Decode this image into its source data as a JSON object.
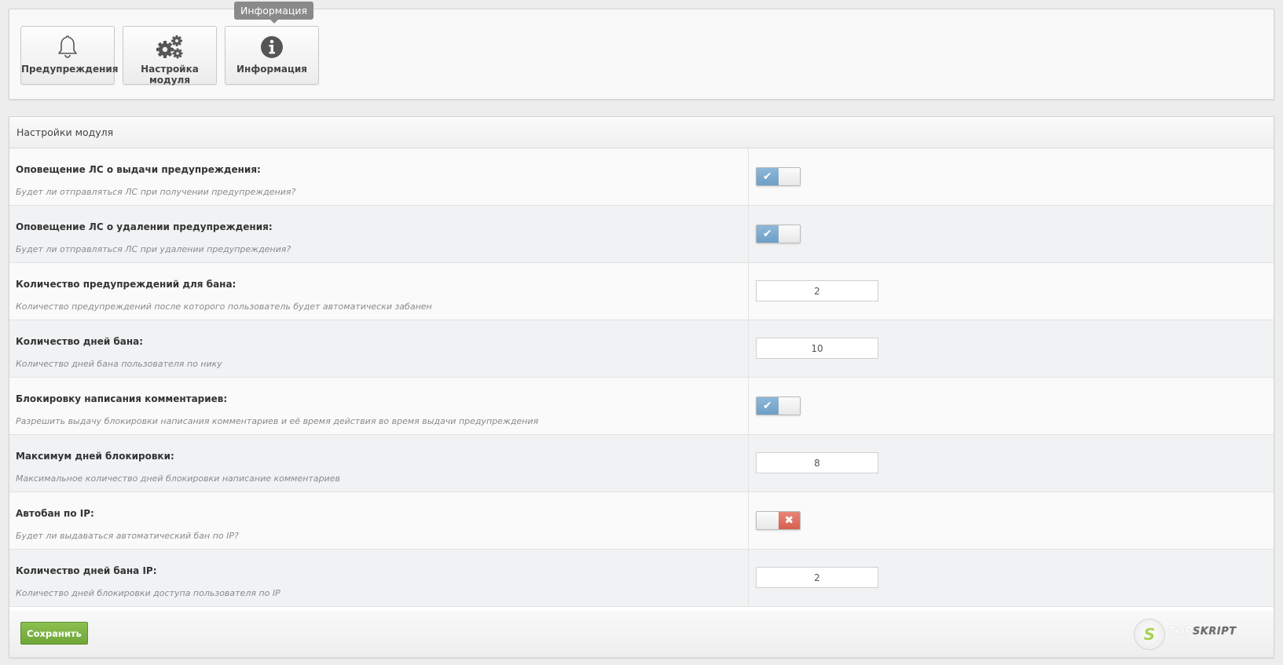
{
  "toolbar": {
    "buttons": [
      {
        "label": "Предупреждения",
        "icon": "bell-icon"
      },
      {
        "label": "Настройка модуля",
        "icon": "gears-icon"
      },
      {
        "label": "Информация",
        "icon": "info-icon"
      }
    ],
    "tooltip": "Информация"
  },
  "settings": {
    "header": "Настройки модуля",
    "rows": [
      {
        "title": "Оповещение ЛС о выдачи предупреждения:",
        "hint": "Будет ли отправляться ЛС при получении предупреждения?",
        "type": "toggle",
        "enabled": true
      },
      {
        "title": "Оповещение ЛС о удалении предупреждения:",
        "hint": "Будет ли отправляться ЛС при удалении предупреждения?",
        "type": "toggle",
        "enabled": true
      },
      {
        "title": "Количество предупреждений для бана:",
        "hint": "Количество предупреждений после которого пользователь будет автоматически забанен",
        "type": "number",
        "value": "2"
      },
      {
        "title": "Количество дней бана:",
        "hint": "Количество дней бана пользователя по нику",
        "type": "number",
        "value": "10"
      },
      {
        "title": "Блокировку написания комментариев:",
        "hint": "Разрешить выдачу блокировки написания комментариев и её время действия во время выдачи предупреждения",
        "type": "toggle",
        "enabled": true
      },
      {
        "title": "Максимум дней блокировки:",
        "hint": "Максимальное количество дней блокировки написание комментариев",
        "type": "number",
        "value": "8"
      },
      {
        "title": "Автобан по IP:",
        "hint": "Будет ли выдаваться автоматический бан по IP?",
        "type": "toggle",
        "enabled": false
      },
      {
        "title": "Количество дней бана IP:",
        "hint": "Количество дней блокировки доступа пользователя по IP",
        "type": "number",
        "value": "2"
      }
    ],
    "save_label": "Сохранить"
  },
  "watermark": {
    "letter": "S",
    "text_a": "TOP",
    "text_b": "SKRIPT"
  },
  "colors": {
    "toggle_on": "#7aa9cf",
    "toggle_off_x": "#d9665a",
    "save_green": "#7cb342"
  }
}
